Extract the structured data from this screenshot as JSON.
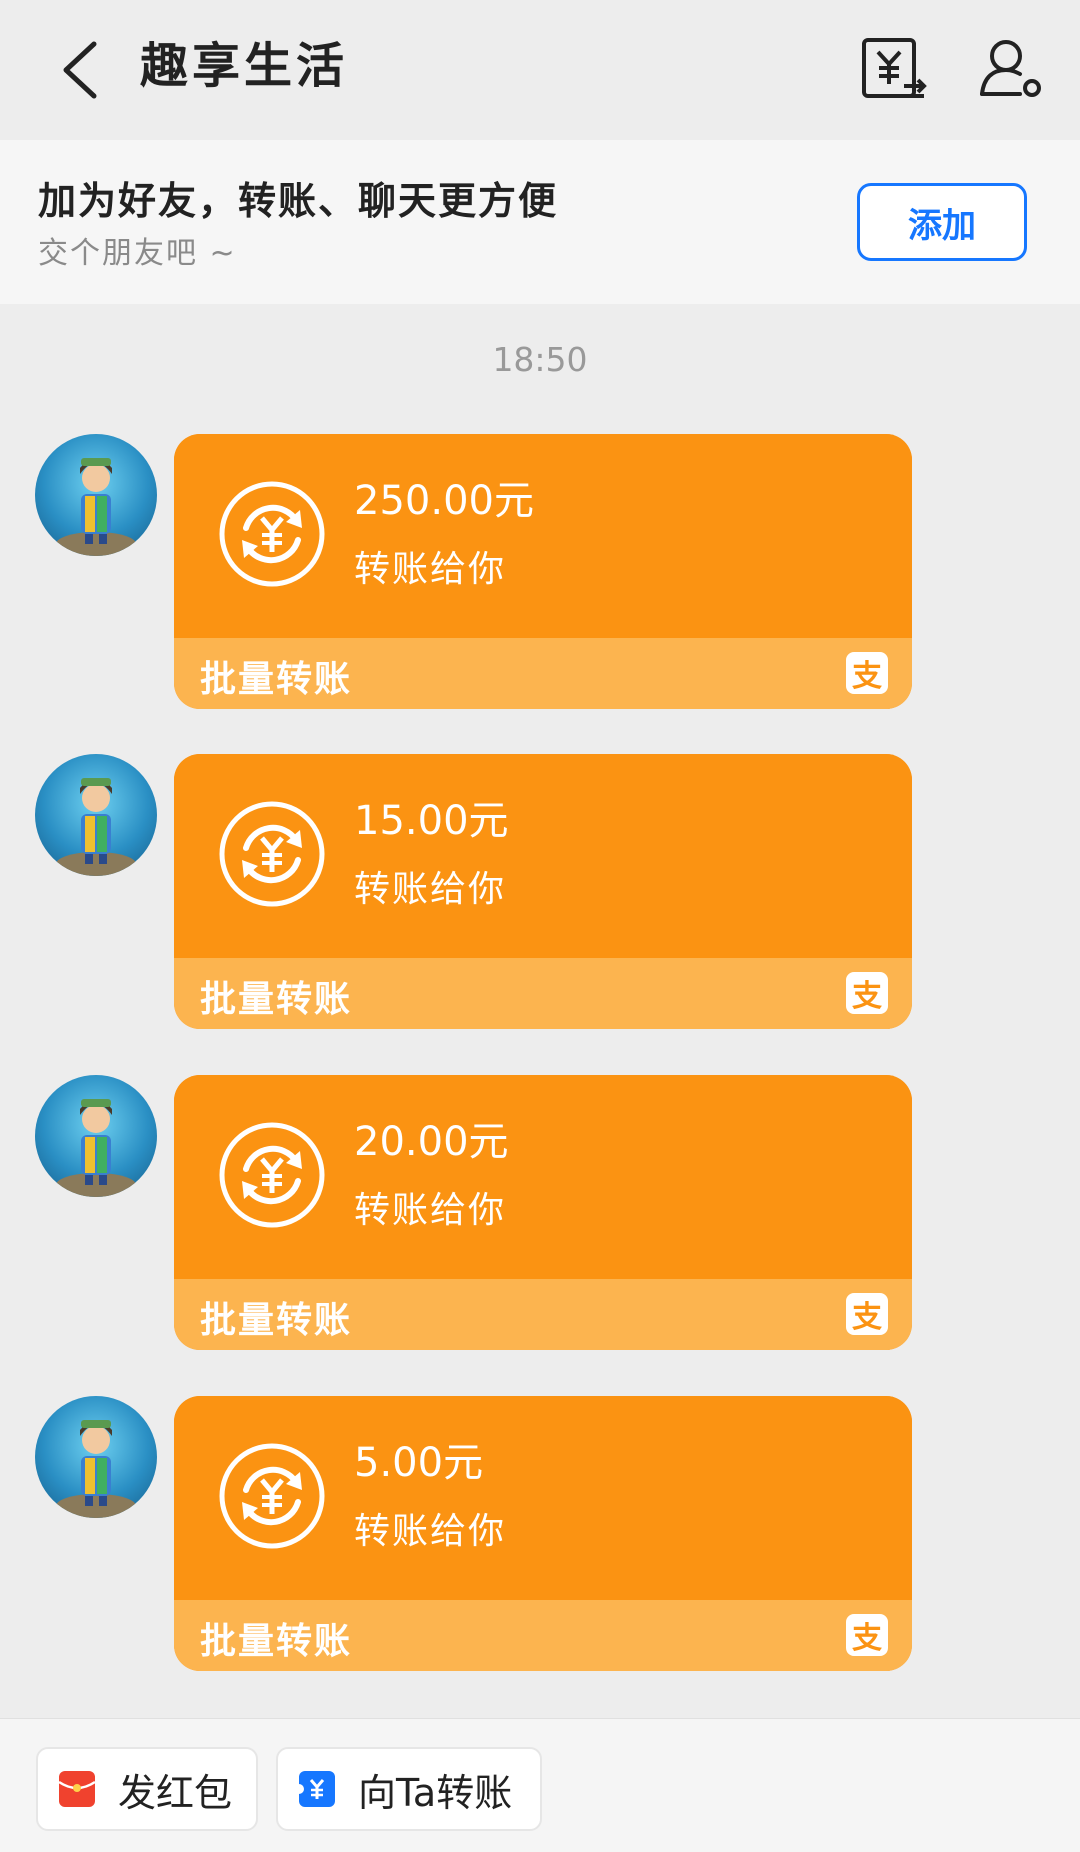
{
  "header": {
    "title": "趣享生活",
    "back_icon": "chevron-left-icon",
    "transfer_icon": "yuan-transfer-icon",
    "profile_icon": "user-settings-icon"
  },
  "friend_banner": {
    "title": "加为好友，转账、聊天更方便",
    "subtitle": "交个朋友吧 ~",
    "add_label": "添加"
  },
  "timestamp": "18:50",
  "messages": [
    {
      "amount": "250.00元",
      "desc": "转账给你",
      "footer": "批量转账",
      "badge": "支"
    },
    {
      "amount": "15.00元",
      "desc": "转账给你",
      "footer": "批量转账",
      "badge": "支"
    },
    {
      "amount": "20.00元",
      "desc": "转账给你",
      "footer": "批量转账",
      "badge": "支"
    },
    {
      "amount": "5.00元",
      "desc": "转账给你",
      "footer": "批量转账",
      "badge": "支"
    }
  ],
  "bottom_bar": {
    "red_packet_label": "发红包",
    "transfer_label": "向Ta转账"
  },
  "colors": {
    "card_orange": "#fb9312",
    "card_footer": "#fcb44f",
    "accent_blue": "#1677ff",
    "red_packet": "#f0422e"
  }
}
